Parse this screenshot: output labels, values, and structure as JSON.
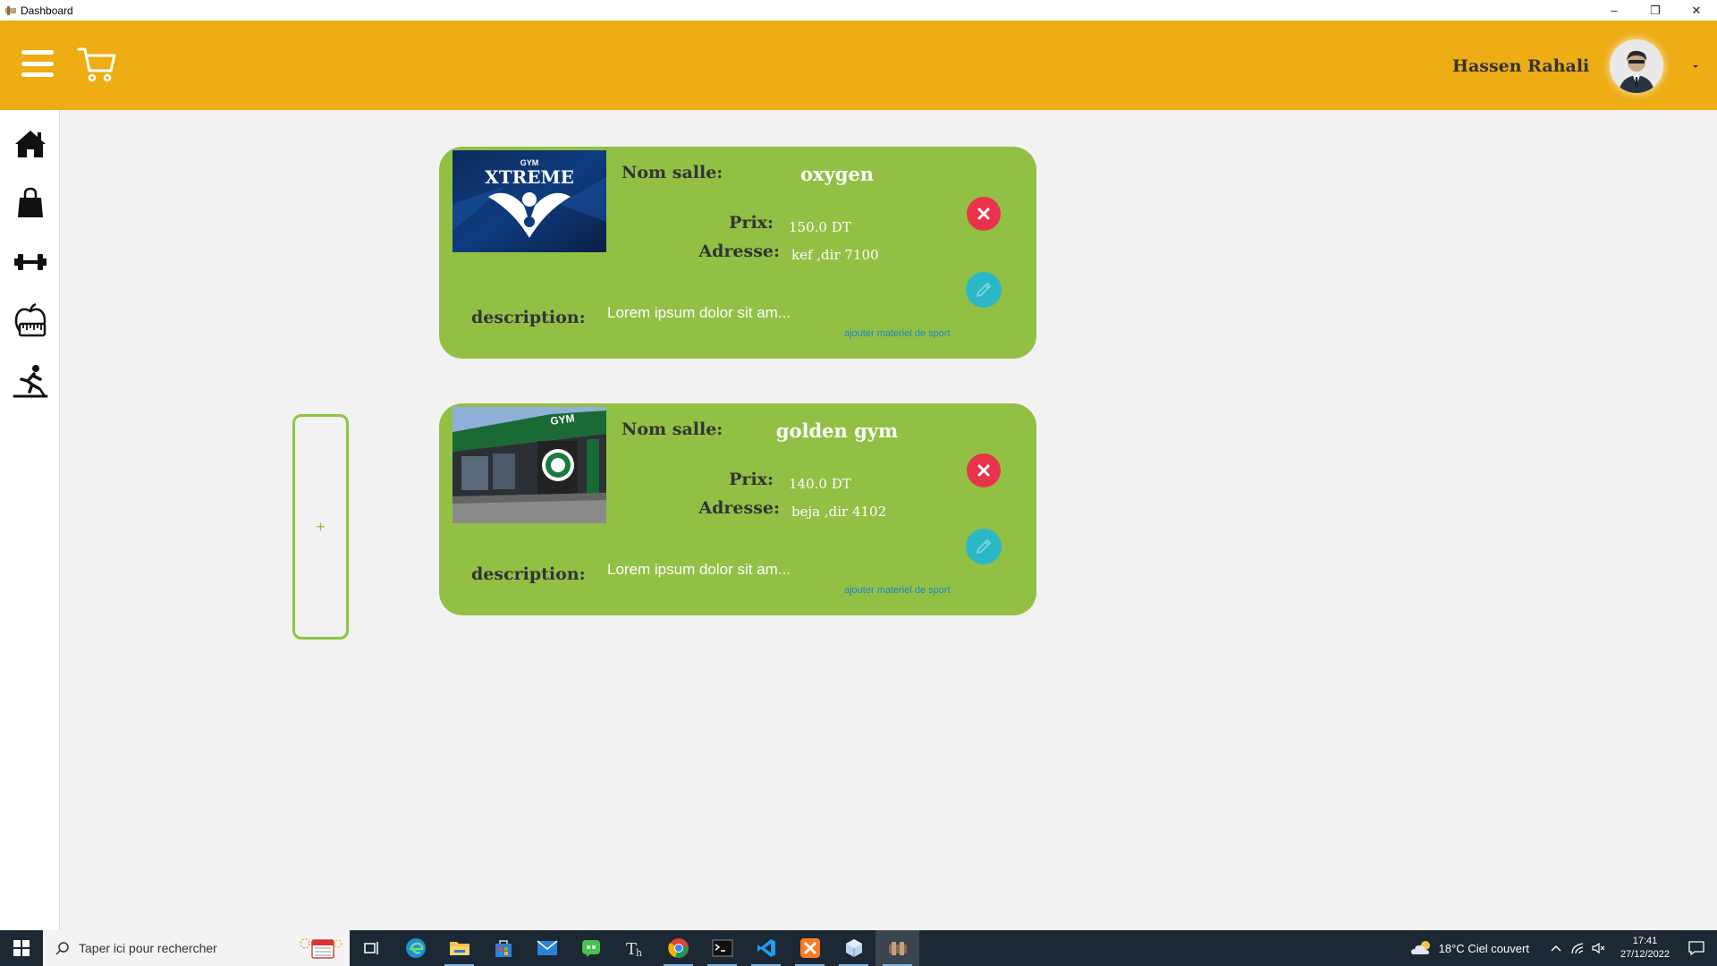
{
  "window": {
    "title": "Dashboard",
    "minimize": "–",
    "restore": "❐",
    "close": "✕"
  },
  "header": {
    "user_name": "Hassen Rahali"
  },
  "sidebar": {
    "items": [
      {
        "icon": "home-icon"
      },
      {
        "icon": "shopping-bag-icon"
      },
      {
        "icon": "dumbbell-icon"
      },
      {
        "icon": "apple-scale-icon"
      },
      {
        "icon": "treadmill-runner-icon"
      }
    ]
  },
  "labels": {
    "nom_salle": "Nom salle:",
    "prix": "Prix:",
    "adresse": "Adresse:",
    "description": "description:",
    "add_equipment_link": "ajouter materiel de sport"
  },
  "gyms": [
    {
      "name": "oxygen",
      "price": "150.0 DT",
      "address": "kef ,dir 7100",
      "description": "Lorem ipsum dolor sit am...",
      "image_text_small": "GYM",
      "image_text_big": "XTREME"
    },
    {
      "name": "golden gym",
      "price": "140.0 DT",
      "address": "beja ,dir 4102",
      "description": "Lorem ipsum dolor sit am...",
      "image_text_small": "GYM"
    }
  ],
  "add_card": {
    "label": "+"
  },
  "taskbar": {
    "search_placeholder": "Taper ici pour rechercher",
    "weather": "18°C  Ciel couvert",
    "time": "17:41",
    "date": "27/12/2022"
  },
  "colors": {
    "header": "#eeac15",
    "card": "#92c045",
    "delete": "#e8344a",
    "edit": "#2bb8c6",
    "link": "#1f82c9"
  }
}
